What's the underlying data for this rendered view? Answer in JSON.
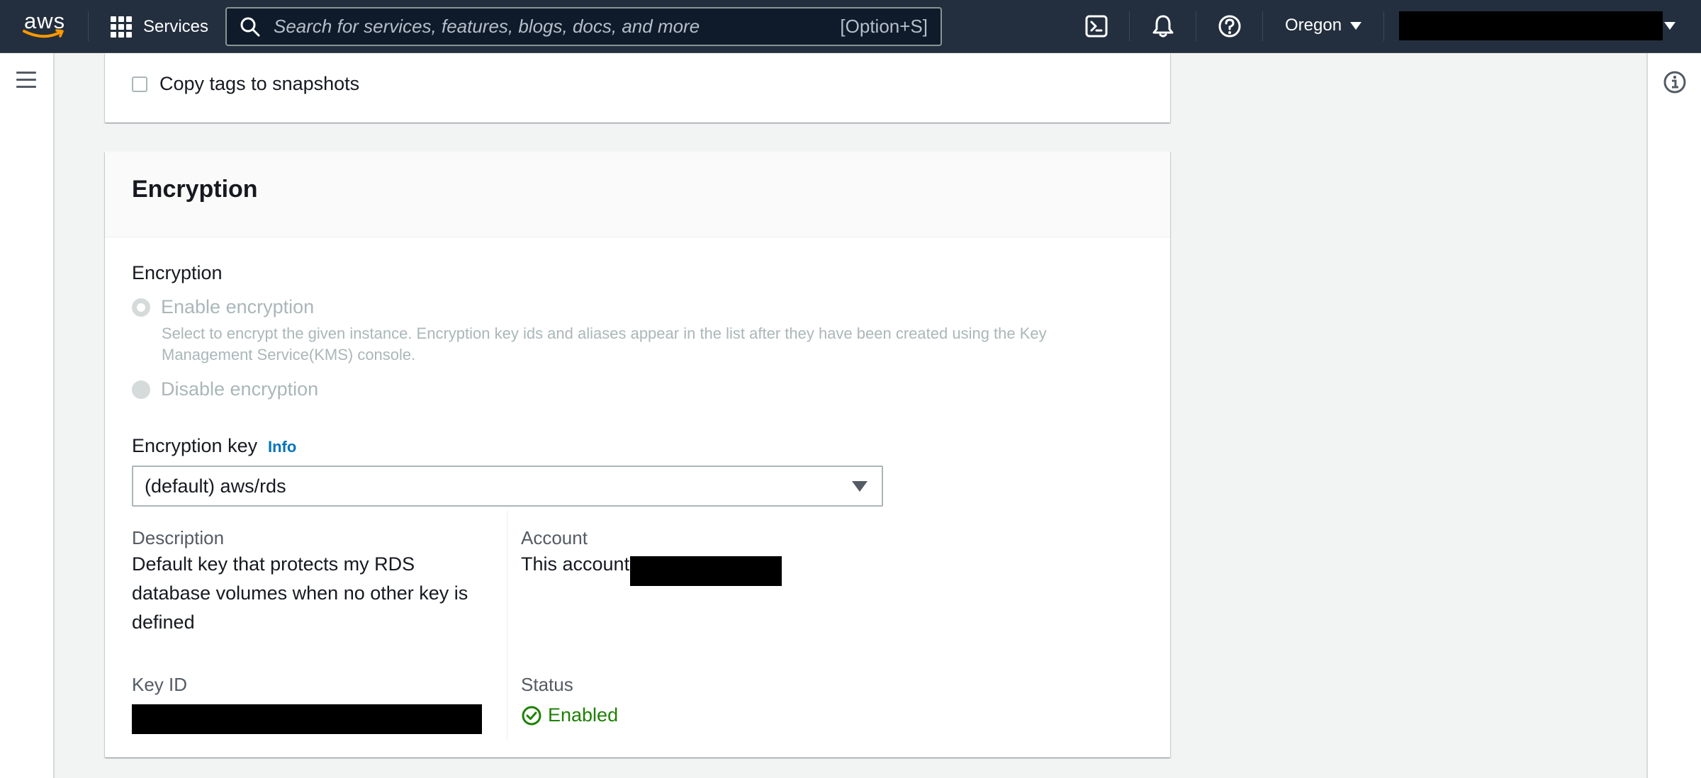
{
  "topnav": {
    "logo_text": "aws",
    "services_label": "Services",
    "search_placeholder": "Search for services, features, blogs, docs, and more",
    "search_shortcut": "[Option+S]",
    "region_label": "Oregon"
  },
  "top_card": {
    "copy_tags_label": "Copy tags to snapshots",
    "copy_tags_checked": false
  },
  "encryption": {
    "section_title": "Encryption",
    "field_label": "Encryption",
    "options": [
      {
        "label": "Enable encryption",
        "description_line1": "Select to encrypt the given instance. Encryption key ids and aliases appear in the list after they have been created using the Key",
        "description_line2": "Management Service(KMS) console.",
        "selected": true,
        "disabled": true
      },
      {
        "label": "Disable encryption",
        "selected": false,
        "disabled": true
      }
    ],
    "key_label": "Encryption key",
    "key_info_link": "Info",
    "key_selected": "(default) aws/rds",
    "details": {
      "description_label": "Description",
      "description_lines": [
        "Default key that protects my RDS",
        "database volumes when no other key is",
        "defined"
      ],
      "account_label": "Account",
      "account_value": "This account",
      "key_id_label": "Key ID",
      "status_label": "Status",
      "status_value": "Enabled"
    }
  },
  "colors": {
    "nav_bg": "#232f3e",
    "link": "#0073bb",
    "success": "#1d8102",
    "disabled_text": "#aab7b8"
  }
}
